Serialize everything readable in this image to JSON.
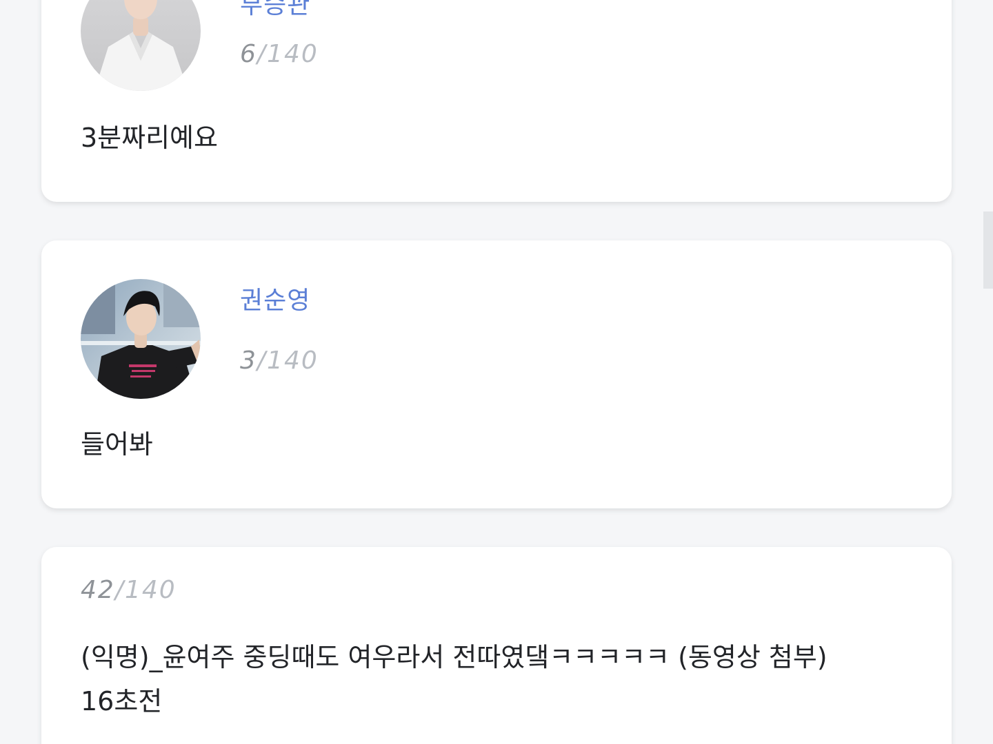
{
  "posts": [
    {
      "author": "부승관",
      "count_current": "6",
      "count_max": "/140",
      "text": "3분짜리예요"
    },
    {
      "author": "권순영",
      "count_current": "3",
      "count_max": "/140",
      "text": "들어봐"
    },
    {
      "count_current": "42",
      "count_max": "/140",
      "text": "(익명)_윤여주 중딩때도 여우라서 전따였댘ㅋㅋㅋㅋㅋ (동영상 첨부)",
      "timestamp": "16초전"
    }
  ],
  "colors": {
    "name": "#5b7fd6",
    "count": "#b8bcc2",
    "text": "#222428",
    "background": "#f5f6f8"
  }
}
